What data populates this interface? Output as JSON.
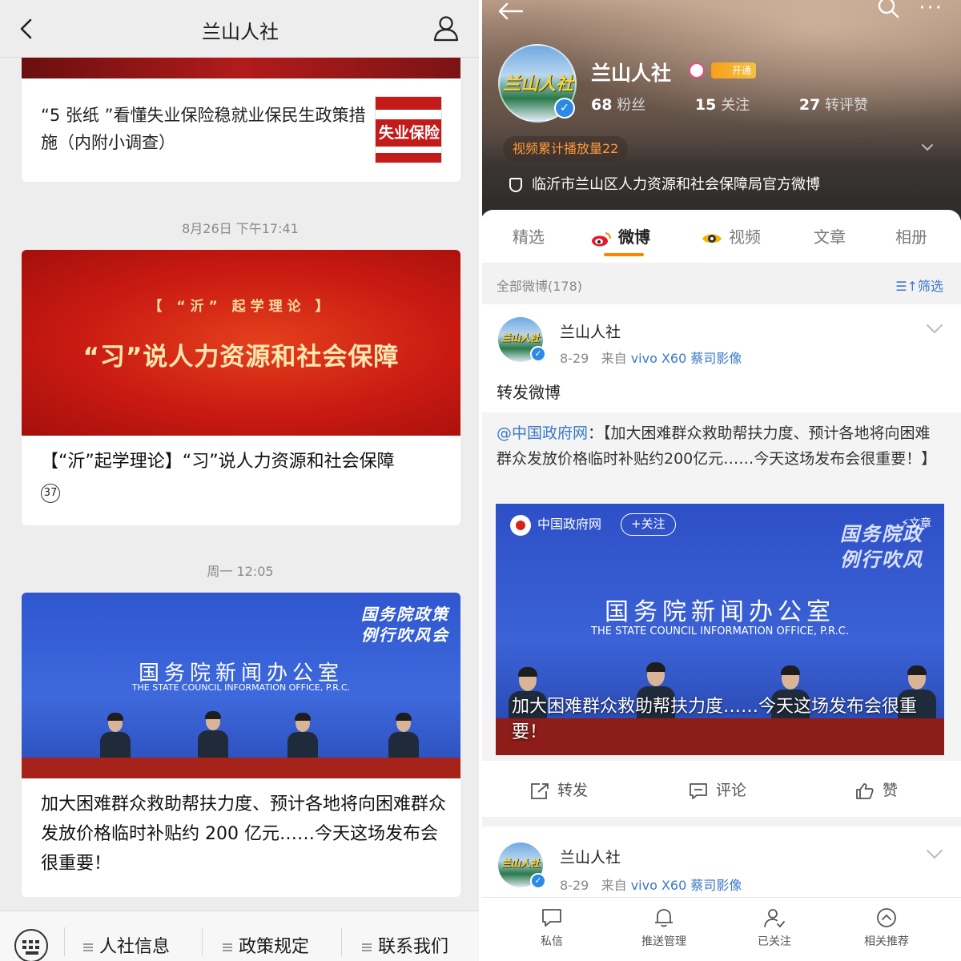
{
  "left": {
    "nav": {
      "title": "兰山人社"
    },
    "card1": {
      "text": "“5 张纸 ”看懂失业保险稳就业保民生政策措施（内附小调查）",
      "thumb_text": "失业保险"
    },
    "time1": "8月26日 下午17:41",
    "card2": {
      "banner_sub": "【 “沂” 起学理论 】",
      "banner_main": "“习”说人力资源和社会保障",
      "caption": "【“沂”起学理论】“习”说人力资源和社会保障",
      "badge": "37"
    },
    "time2": "周一 12:05",
    "card3": {
      "corner_line1": "国务院政策",
      "corner_line2": "例行吹风会",
      "office_cn": "国务院新闻办公室",
      "office_en": "THE STATE COUNCIL INFORMATION OFFICE, P.R.C.",
      "caption": "加大困难群众救助帮扶力度、预计各地将向困难群众发放价格临时补贴约 200 亿元……今天这场发布会很重要！"
    },
    "bottom_menu": [
      "人社信息",
      "政策规定",
      "联系我们"
    ]
  },
  "right": {
    "profile": {
      "name": "兰山人社",
      "vip_badge": "开通",
      "fans_num": "68",
      "fans_label": "粉丝",
      "follow_num": "15",
      "follow_label": "关注",
      "likes_num": "27",
      "likes_label": "转评赞",
      "video_plays": "视频累计播放量22",
      "official": "临沂市兰山区人力资源和社会保障局官方微博",
      "avatar_text": "兰山人社"
    },
    "tabs": [
      "精选",
      "微博",
      "视频",
      "文章",
      "相册"
    ],
    "filter": {
      "count": "全部微博(178)",
      "button": "筛选"
    },
    "post1": {
      "name": "兰山人社",
      "date": "8-29",
      "from_label": "来自",
      "device": "vivo X60 蔡司影像",
      "body": "转发微博",
      "repost_at": "@中国政府网",
      "repost_text": "：【加大困难群众救助帮扶力度、预计各地将向困难群众发放价格临时补贴约200亿元……今天这场发布会很重要！】",
      "video": {
        "source": "中国政府网",
        "follow": "+关注",
        "article": "⚡文章",
        "corner": "国务院政\n例行吹风",
        "office_cn": "国务院新闻办公室",
        "office_en": "THE STATE COUNCIL INFORMATION OFFICE, P.R.C.",
        "caption": "加大困难群众救助帮扶力度……今天这场发布会很重要！"
      },
      "actions": [
        "转发",
        "评论",
        "赞"
      ]
    },
    "post2": {
      "name": "兰山人社",
      "date": "8-29",
      "from_label": "来自",
      "device": "vivo X60 蔡司影像"
    },
    "bottom_bar": [
      "私信",
      "推送管理",
      "已关注",
      "相关推荐"
    ],
    "colors": {
      "accent": "#ff8200",
      "link": "#3a78c8"
    }
  }
}
